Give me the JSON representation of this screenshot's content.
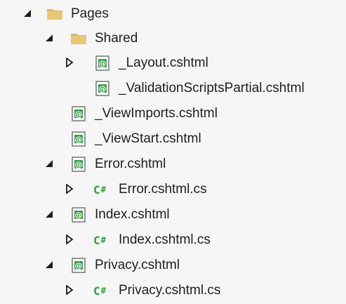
{
  "tree": {
    "pages": {
      "label": "Pages"
    },
    "shared": {
      "label": "Shared"
    },
    "layout": {
      "label": "_Layout.cshtml"
    },
    "validation": {
      "label": "_ValidationScriptsPartial.cshtml"
    },
    "viewimports": {
      "label": "_ViewImports.cshtml"
    },
    "viewstart": {
      "label": "_ViewStart.cshtml"
    },
    "error": {
      "label": "Error.cshtml"
    },
    "error_cs": {
      "label": "Error.cshtml.cs"
    },
    "index": {
      "label": "Index.cshtml"
    },
    "index_cs": {
      "label": "Index.cshtml.cs"
    },
    "privacy": {
      "label": "Privacy.cshtml"
    },
    "privacy_cs": {
      "label": "Privacy.cshtml.cs"
    },
    "cs_badge": {
      "c": "C",
      "hash": "#"
    }
  }
}
